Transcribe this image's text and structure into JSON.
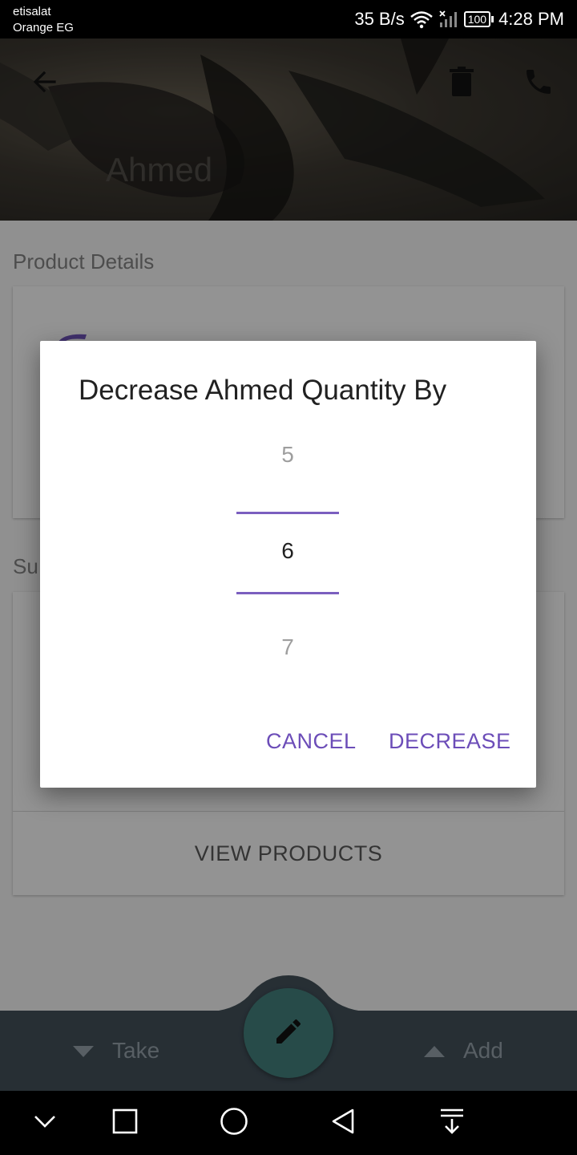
{
  "status_bar": {
    "carrier_1": "etisalat",
    "carrier_2": "Orange EG",
    "net_speed": "35 B/s",
    "battery": "100",
    "time": "4:28 PM"
  },
  "header": {
    "title": "Ahmed"
  },
  "content": {
    "product_details_title": "Product Details",
    "supplier_section_title": "Su",
    "view_products_label": "VIEW PRODUCTS"
  },
  "bottom_bar": {
    "take_label": "Take",
    "add_label": "Add"
  },
  "dialog": {
    "title": "Decrease Ahmed Quantity By",
    "picker": {
      "previous": "5",
      "current": "6",
      "next": "7"
    },
    "cancel_label": "CANCEL",
    "decrease_label": "DECREASE"
  },
  "colors": {
    "accent": "#6c4db8",
    "picker_line": "#7b5fbf",
    "bottom_bar": "#3f4c55",
    "fab": "#3f7a76"
  },
  "icons": [
    "back-arrow-icon",
    "delete-icon",
    "phone-icon",
    "wifi-icon",
    "signal-icon",
    "triangle-down-icon",
    "triangle-up-icon",
    "pencil-icon",
    "chevron-down-icon",
    "square-icon",
    "circle-icon",
    "back-triangle-icon",
    "download-icon"
  ]
}
